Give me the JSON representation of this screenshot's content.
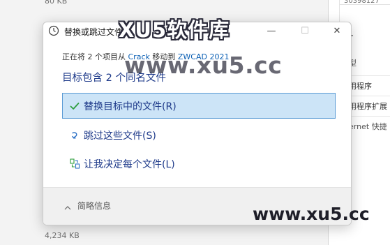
{
  "background": {
    "size_top": "80 KB",
    "size_bottom": "4,234 KB",
    "right_id": "30398127",
    "right_fragments": [
      "型",
      "用程序",
      "用程序扩展",
      "ernet 快捷"
    ]
  },
  "dialog": {
    "title": "替换或跳过文件",
    "window_buttons": {
      "minimize": "—",
      "maximize": "☐",
      "close": "✕"
    },
    "info": {
      "prefix": "正在将 2 个项目从 ",
      "source": "Crack",
      "middle": " 移动到 ",
      "destination": "ZWCAD 2021"
    },
    "heading": "目标包含 2 个同名文件",
    "options": [
      {
        "label": "替换目标中的文件(R)",
        "icon": "checkmark-icon",
        "selected": true
      },
      {
        "label": "跳过这些文件(S)",
        "icon": "skip-arrow-icon",
        "selected": false
      },
      {
        "label": "让我决定每个文件(L)",
        "icon": "decide-files-icon",
        "selected": false
      }
    ],
    "footer": {
      "toggle_label": "简略信息",
      "icon": "chevron-up-icon"
    }
  },
  "watermark": {
    "title": "XU5软件库",
    "url": "www.xu5.cc",
    "url_corner": "www.xu5.cc"
  },
  "colors": {
    "accent_text": "#1e3a8a",
    "link": "#0a5fb4",
    "selected_bg": "#cce4f7",
    "selected_border": "#5a9bd5",
    "check_green": "#2e9e3e"
  }
}
